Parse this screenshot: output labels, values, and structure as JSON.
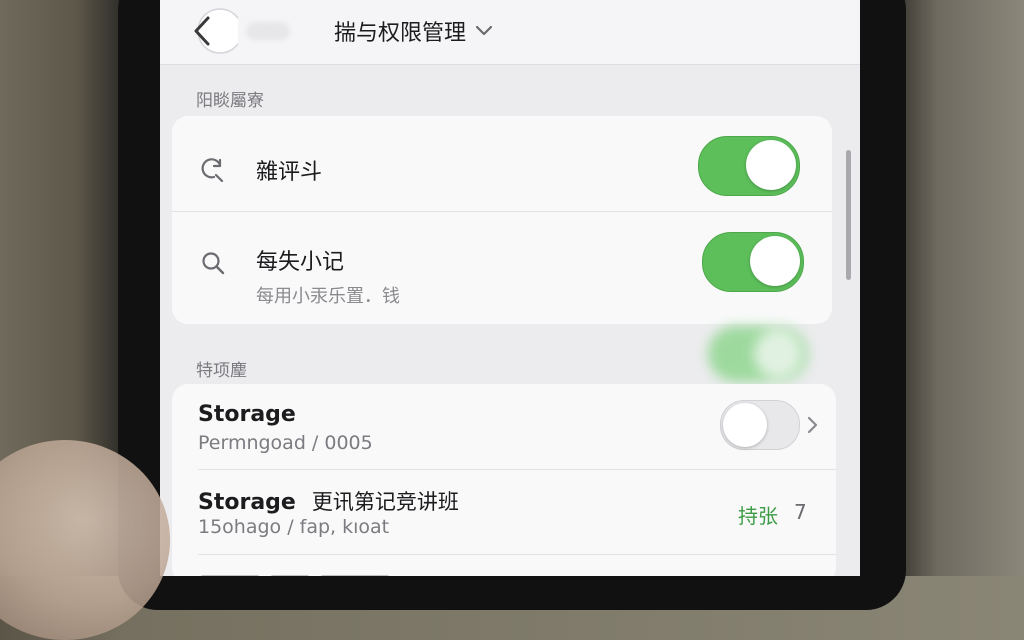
{
  "header": {
    "title": "揣与权限管理"
  },
  "section1": {
    "label": "阳睒屬寮",
    "rows": [
      {
        "title": "雜评斗",
        "subtitle": "",
        "toggle": "on",
        "icon": "refresh-search-icon"
      },
      {
        "title": "每失小记",
        "subtitle": "每用小汞乐置．钱",
        "toggle": "on",
        "icon": "search-icon"
      }
    ]
  },
  "section2": {
    "label": "特项麈",
    "rows": [
      {
        "title": "Storage",
        "subtitle": "Permngoad /  0005",
        "toggle": "off",
        "chevron": true
      },
      {
        "title": "Storage",
        "title_suffix": "更讯第记竞讲班",
        "subtitle": "15ohago /  fap,  kıoat",
        "status": "持张",
        "count": "7"
      }
    ]
  },
  "colors": {
    "toggle_on": "#5cbf5a",
    "status_green": "#3d9b45",
    "screen_bg": "#ececee"
  }
}
